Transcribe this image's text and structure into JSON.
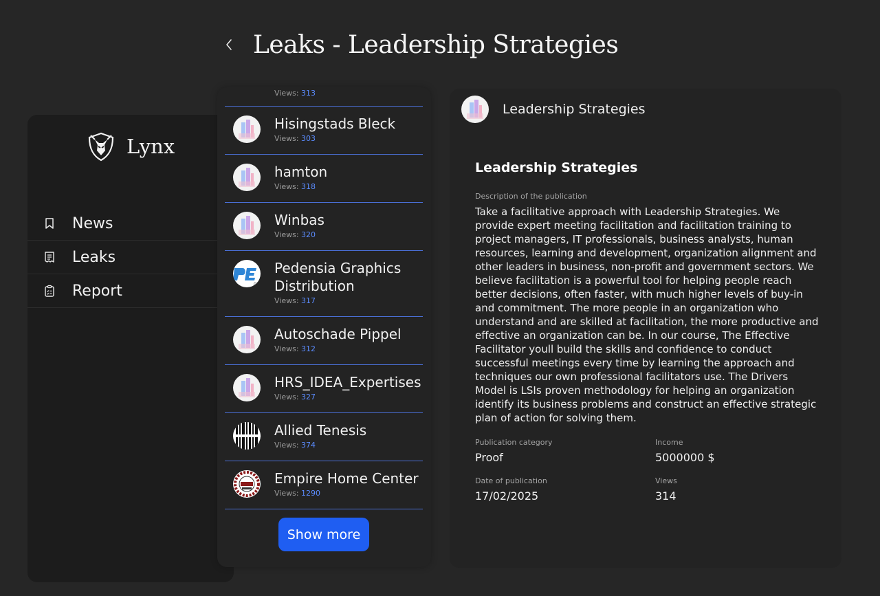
{
  "header": {
    "title": "Leaks - Leadership Strategies"
  },
  "sidebar": {
    "logo_text": "Lynx",
    "nav": [
      {
        "label": "News",
        "icon": "bookmark-icon"
      },
      {
        "label": "Leaks",
        "icon": "receipt-icon"
      },
      {
        "label": "Report",
        "icon": "checklist-icon"
      }
    ]
  },
  "list": {
    "views_label": "Views:",
    "partial_views": "313",
    "items": [
      {
        "name": "Hisingstads Bleck",
        "views": "303",
        "avatar": "chart-logo"
      },
      {
        "name": "hamton",
        "views": "318",
        "avatar": "chart-logo"
      },
      {
        "name": "Winbas",
        "views": "320",
        "avatar": "chart-logo"
      },
      {
        "name": "Pedensia Graphics Distribution",
        "views": "317",
        "avatar": "pe-logo"
      },
      {
        "name": "Autoschade Pippel",
        "views": "312",
        "avatar": "chart-logo"
      },
      {
        "name": "HRS_IDEA_Expertises",
        "views": "327",
        "avatar": "chart-logo"
      },
      {
        "name": "Allied Tenesis",
        "views": "374",
        "avatar": "stripes-logo"
      },
      {
        "name": "Empire Home Center",
        "views": "1290",
        "avatar": "badge-logo"
      }
    ],
    "show_more": "Show more"
  },
  "detail": {
    "header_title": "Leadership Strategies",
    "title": "Leadership Strategies",
    "description_label": "Description of the publication",
    "description": "Take a facilitative approach with Leadership Strategies. We provide expert meeting facilitation and facilitation training to project managers, IT professionals, business analysts, human resources, learning and development, organization alignment and other leaders in business, non-profit and government sectors. We believe facilitation is a powerful tool for helping people reach better decisions, often faster, with much higher levels of buy-in and commitment. The more people in an organization who understand and are skilled at facilitation, the more productive and effective an organization can be. In our course, The Effective Facilitator youll build the skills and confidence to conduct successful meetings every time by learning the approach and techniques our own professional facilitators use. The Drivers Model is LSIs proven methodology for helping an organization identify its business problems and construct an effective strategic plan of action for solving them.",
    "category_label": "Publication category",
    "category": "Proof",
    "income_label": "Income",
    "income": "5000000 $",
    "date_label": "Date of publication",
    "date": "17/02/2025",
    "views_label": "Views",
    "views": "314"
  },
  "colors": {
    "accent": "#1f5ef2",
    "views_number": "#5b8cff",
    "divider": "#4a6fd6"
  }
}
